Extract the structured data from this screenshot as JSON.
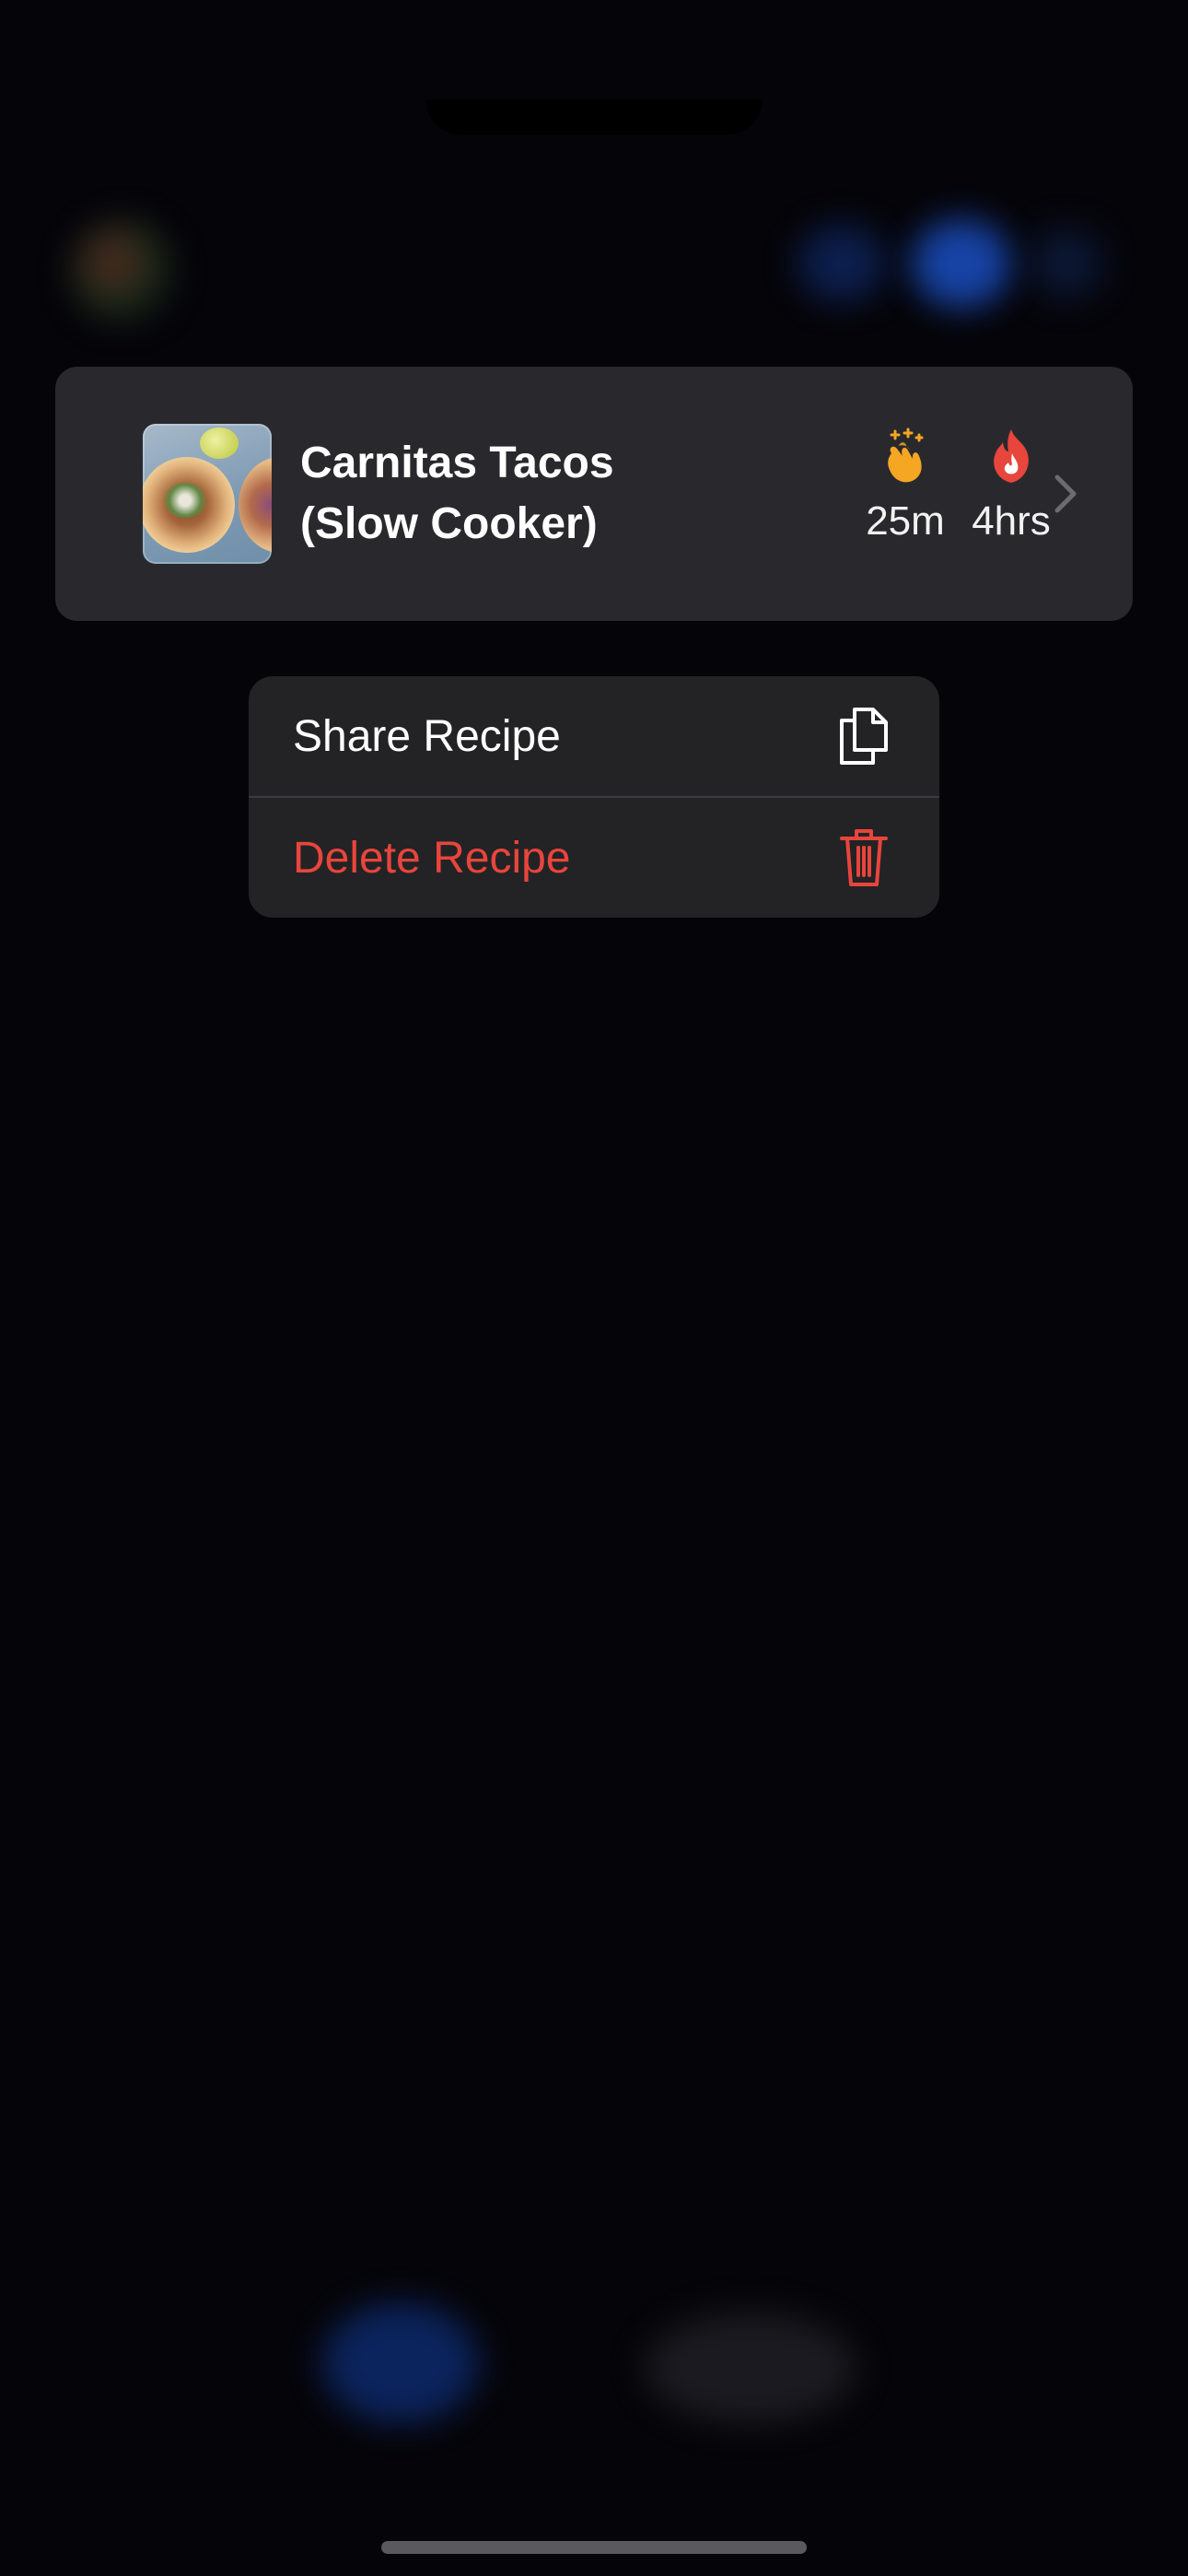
{
  "recipe_card": {
    "title_line1": "Carnitas Tacos",
    "title_line2": "(Slow Cooker)",
    "prep_time": "25m",
    "cook_time": "4hrs",
    "prep_icon": "clapping-hands-icon",
    "cook_icon": "flame-icon",
    "prep_icon_color": "#F5A623",
    "cook_icon_color": "#E8453C"
  },
  "context_menu": {
    "items": [
      {
        "label": "Share Recipe",
        "icon": "copy-documents-icon",
        "color": "#FFFFFF"
      },
      {
        "label": "Delete Recipe",
        "icon": "trash-icon",
        "color": "#E8453C"
      }
    ]
  },
  "colors": {
    "background": "#050409",
    "card": "#29292D",
    "menu": "#232325",
    "destructive": "#E8453C"
  }
}
